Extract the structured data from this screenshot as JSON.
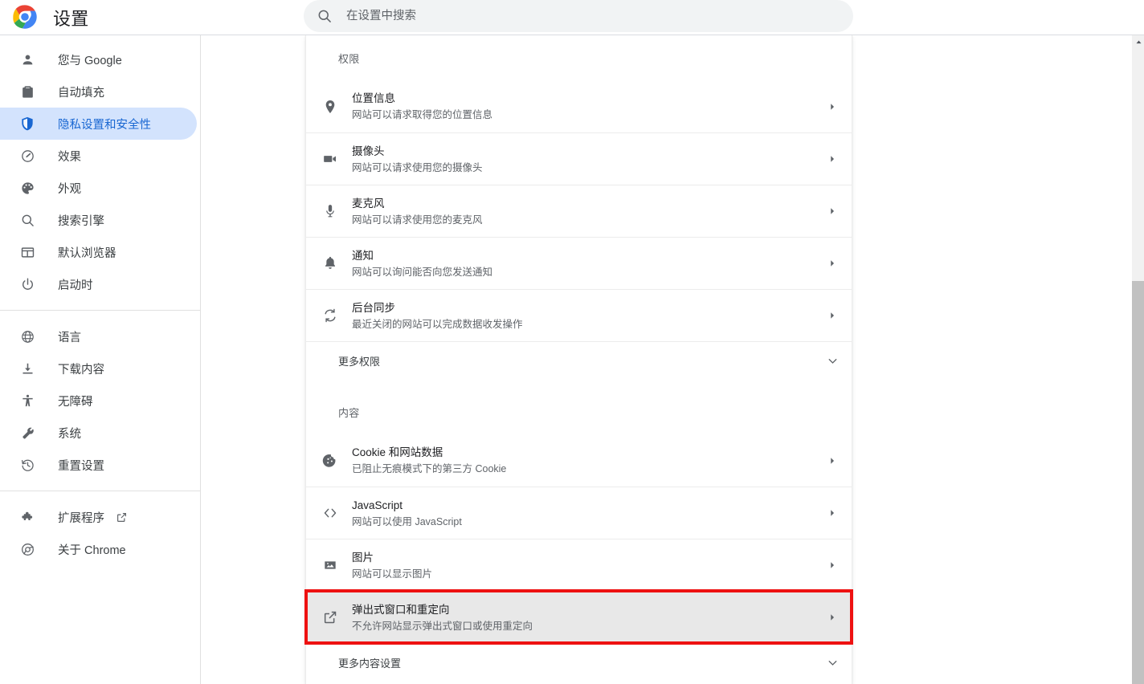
{
  "window": {
    "app_title": "设置",
    "logo_icon": "chrome-logo"
  },
  "search": {
    "placeholder": "在设置中搜索",
    "value": "",
    "icon": "search-icon"
  },
  "sidebar": {
    "groups": [
      {
        "items": [
          {
            "label": "您与 Google",
            "icon": "person-icon",
            "selected": false
          },
          {
            "label": "自动填充",
            "icon": "clipboard-icon",
            "selected": false
          },
          {
            "label": "隐私设置和安全性",
            "icon": "shield-icon",
            "selected": true
          },
          {
            "label": "效果",
            "icon": "speedometer-icon",
            "selected": false
          },
          {
            "label": "外观",
            "icon": "palette-icon",
            "selected": false
          },
          {
            "label": "搜索引擎",
            "icon": "search-icon",
            "selected": false
          },
          {
            "label": "默认浏览器",
            "icon": "browser-window-icon",
            "selected": false
          },
          {
            "label": "启动时",
            "icon": "power-icon",
            "selected": false
          }
        ]
      },
      {
        "items": [
          {
            "label": "语言",
            "icon": "globe-icon",
            "selected": false
          },
          {
            "label": "下载内容",
            "icon": "download-icon",
            "selected": false
          },
          {
            "label": "无障碍",
            "icon": "accessibility-icon",
            "selected": false
          },
          {
            "label": "系统",
            "icon": "wrench-icon",
            "selected": false
          },
          {
            "label": "重置设置",
            "icon": "history-restore-icon",
            "selected": false
          }
        ]
      },
      {
        "items": [
          {
            "label": "扩展程序",
            "icon": "puzzle-icon",
            "selected": false,
            "external": true,
            "external_icon": "open-in-new-icon"
          },
          {
            "label": "关于 Chrome",
            "icon": "chrome-outline-icon",
            "selected": false
          }
        ]
      }
    ]
  },
  "main": {
    "permissions_section": {
      "heading": "权限",
      "rows": [
        {
          "title": "位置信息",
          "subtitle": "网站可以请求取得您的位置信息",
          "icon": "location-pin-icon",
          "arrow": "chevron-right-icon"
        },
        {
          "title": "摄像头",
          "subtitle": "网站可以请求使用您的摄像头",
          "icon": "videocam-icon",
          "arrow": "chevron-right-icon"
        },
        {
          "title": "麦克风",
          "subtitle": "网站可以请求使用您的麦克风",
          "icon": "microphone-icon",
          "arrow": "chevron-right-icon"
        },
        {
          "title": "通知",
          "subtitle": "网站可以询问能否向您发送通知",
          "icon": "bell-icon",
          "arrow": "chevron-right-icon"
        },
        {
          "title": "后台同步",
          "subtitle": "最近关闭的网站可以完成数据收发操作",
          "icon": "sync-icon",
          "arrow": "chevron-right-icon"
        }
      ],
      "expander": {
        "label": "更多权限",
        "icon": "chevron-down-icon"
      }
    },
    "content_section": {
      "heading": "内容",
      "rows": [
        {
          "title": "Cookie 和网站数据",
          "subtitle": "已阻止无痕模式下的第三方 Cookie",
          "icon": "cookie-icon",
          "arrow": "chevron-right-icon",
          "highlighted": false
        },
        {
          "title": "JavaScript",
          "subtitle": "网站可以使用 JavaScript",
          "icon": "code-brackets-icon",
          "arrow": "chevron-right-icon",
          "highlighted": false
        },
        {
          "title": "图片",
          "subtitle": "网站可以显示图片",
          "icon": "image-icon",
          "arrow": "chevron-right-icon",
          "highlighted": false
        },
        {
          "title": "弹出式窗口和重定向",
          "subtitle": "不允许网站显示弹出式窗口或使用重定向",
          "icon": "open-in-new-icon",
          "arrow": "chevron-right-icon",
          "highlighted": true
        }
      ],
      "expander": {
        "label": "更多内容设置",
        "icon": "chevron-down-icon"
      }
    }
  },
  "scrollbar": {
    "up_arrow_icon": "caret-up-icon"
  },
  "colors": {
    "accent": "#1a73e8",
    "selected_nav_bg": "#d3e3fd",
    "highlight_outline": "#ee1111",
    "highlight_row_bg": "#e8e8e8",
    "text_primary": "#202124",
    "text_secondary": "#5f6368"
  }
}
